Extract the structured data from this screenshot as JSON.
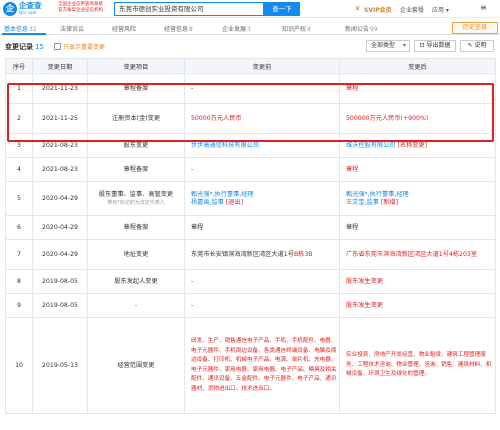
{
  "header": {
    "logo_mark": "企",
    "logo_text": "企查查",
    "logo_sub": "Qcc.com",
    "slogan": [
      "全国企业信用查询系统",
      "官方备案企业征信机构"
    ],
    "search_value": "东莞市德创实业投资有限公司",
    "search_button": "查一下",
    "svip": "SVIP会员",
    "enterprise_link": "企业套餐",
    "apps_link": "应用 ▾",
    "more_icon": "≡"
  },
  "tabs": [
    {
      "label": "基本信息",
      "count": "31"
    },
    {
      "label": "法律诉讼",
      "count": ""
    },
    {
      "label": "经营风险",
      "count": ""
    },
    {
      "label": "经营信息",
      "count": "8"
    },
    {
      "label": "企业发展",
      "count": "3"
    },
    {
      "label": "知识产权",
      "count": "4"
    },
    {
      "label": "新闻公告",
      "count": "99"
    }
  ],
  "history_tab": "历史信息",
  "section": {
    "title": "变更记录",
    "count": "15",
    "filter_label": "只显示重要变更",
    "select_label": "全部类型",
    "select_arrow": "▾",
    "export_button": "⊡ 导出数据",
    "help_button": "✎ 说明"
  },
  "table": {
    "headers": [
      "序号",
      "变更日期",
      "变更项目",
      "变更前",
      "变更后"
    ],
    "rows": [
      {
        "idx": "1",
        "date": "2021-11-23",
        "item": "章程备案",
        "before": "-",
        "after": "章程"
      },
      {
        "idx": "2",
        "date": "2021-11-25",
        "item": "注册资本(金)变更",
        "before": "50000万元人民币",
        "after": "500000万元人民币(+900%)"
      },
      {
        "idx": "3",
        "date": "2021-08-23",
        "item": "股东变更",
        "before": "步步高通信科技有限公司",
        "after": "维沃控股有限公司",
        "after_tag": "[名称变更]"
      },
      {
        "idx": "4",
        "date": "2021-08-23",
        "item": "章程备案",
        "before": "-",
        "after": "章程"
      },
      {
        "idx": "5",
        "date": "2020-04-29",
        "item": "股东董事、监事、高管变更",
        "item_note": "带有*标记的为法定代表人",
        "before_l1": "甄光强*,执行董事,经理",
        "before_l2": "杨嘉禹,监事",
        "before_tag": "[退出]",
        "after_l1": "甄光强*,执行董事,经理",
        "after_l2": "王文宝,监事",
        "after_tag": "[新增]"
      },
      {
        "idx": "6",
        "date": "2020-04-29",
        "item": "章程备案",
        "before": "章程",
        "after": "章程"
      },
      {
        "idx": "7",
        "date": "2020-04-29",
        "item": "地址变更",
        "before": "东莞市长安镇滨海湾新区湾区大道1号",
        "before_hl": "B栋3B",
        "after": "广东省东莞市滨海湾新区湾区大道1号",
        "after_hl": "4栋203室"
      },
      {
        "idx": "8",
        "date": "2019-08-05",
        "item": "股东发起人变更",
        "before": "-",
        "after": "股东发生变更"
      },
      {
        "idx": "9",
        "date": "2019-08-05",
        "item": "-",
        "before": "-",
        "after": "股东发生变更"
      },
      {
        "idx": "10",
        "date": "2019-05-13",
        "item": "经营范围变更",
        "before": "研发、生产、销售通信电子产品、手机、手机配件、电器、电子元器件、手机周边设备、各类通信终端设备、电脑及周边设备、打印机、机械电子产品、电源、单片机、充电器、电子元器件、家用电器、家用电器、电子产品、模具及相关配件、通讯设备、五金配件、电子元器件、电子产品、通讯器材、货物进出口、技术进出口。",
        "after": "实业投资、房地产开发经营、物业租赁、建筑工程管理服务、工程技术咨询、物业管理、咨询、销售：建筑材料、机械设备、环境卫生及绿化的管理。"
      }
    ]
  }
}
